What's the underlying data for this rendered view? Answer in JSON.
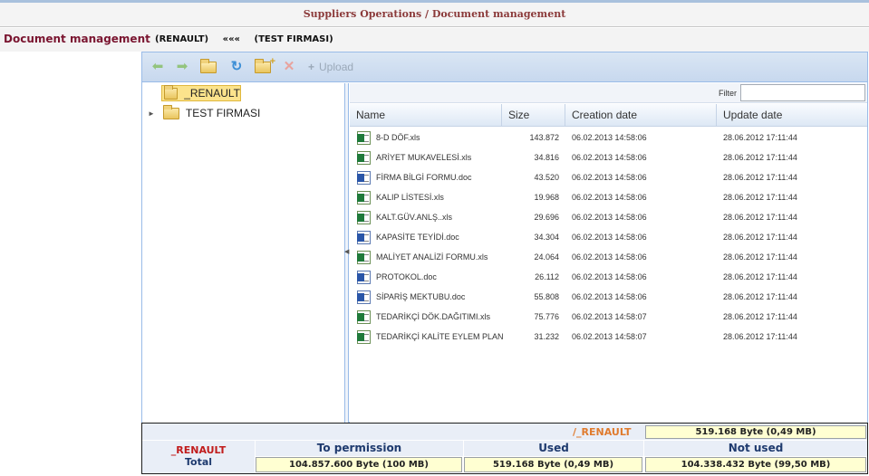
{
  "app": {
    "title": "Suppliers Operations / Document management"
  },
  "header": {
    "section": "Document management",
    "path_left": "(RENAULT)",
    "path_sep": "«««",
    "path_right": "(TEST FIRMASI)"
  },
  "toolbar": {
    "back_icon": "arrow-left-icon",
    "forward_icon": "arrow-right-icon",
    "open_icon": "folder-open-icon",
    "refresh_icon": "refresh-icon",
    "new_folder_icon": "new-folder-icon",
    "delete_icon": "delete-icon",
    "upload_label": "Upload"
  },
  "tree": {
    "nodes": [
      {
        "label": "_RENAULT",
        "selected": true
      },
      {
        "label": "TEST FIRMASI",
        "expandable": true
      }
    ]
  },
  "grid": {
    "filter_label": "Filter",
    "filter_value": "",
    "columns": [
      "Name",
      "Size",
      "Creation date",
      "Update date"
    ],
    "rows": [
      {
        "icon": "excel-file-icon",
        "name": "8-D DÖF.xls",
        "size": "143.872",
        "created": "06.02.2013 14:58:06",
        "updated": "28.06.2012 17:11:44"
      },
      {
        "icon": "excel-file-icon",
        "name": "ARİYET MUKAVELESİ.xls",
        "size": "34.816",
        "created": "06.02.2013 14:58:06",
        "updated": "28.06.2012 17:11:44"
      },
      {
        "icon": "word-file-icon",
        "name": "FİRMA BİLGİ FORMU.doc",
        "size": "43.520",
        "created": "06.02.2013 14:58:06",
        "updated": "28.06.2012 17:11:44"
      },
      {
        "icon": "excel-file-icon",
        "name": "KALIP LİSTESİ.xls",
        "size": "19.968",
        "created": "06.02.2013 14:58:06",
        "updated": "28.06.2012 17:11:44"
      },
      {
        "icon": "excel-file-icon",
        "name": "KALT.GÜV.ANLŞ..xls",
        "size": "29.696",
        "created": "06.02.2013 14:58:06",
        "updated": "28.06.2012 17:11:44"
      },
      {
        "icon": "word-file-icon",
        "name": "KAPASİTE TEYİDİ.doc",
        "size": "34.304",
        "created": "06.02.2013 14:58:06",
        "updated": "28.06.2012 17:11:44"
      },
      {
        "icon": "excel-file-icon",
        "name": "MALİYET ANALİZİ FORMU.xls",
        "size": "24.064",
        "created": "06.02.2013 14:58:06",
        "updated": "28.06.2012 17:11:44"
      },
      {
        "icon": "word-file-icon",
        "name": "PROTOKOL.doc",
        "size": "26.112",
        "created": "06.02.2013 14:58:06",
        "updated": "28.06.2012 17:11:44"
      },
      {
        "icon": "word-file-icon",
        "name": "SİPARİŞ MEKTUBU.doc",
        "size": "55.808",
        "created": "06.02.2013 14:58:06",
        "updated": "28.06.2012 17:11:44"
      },
      {
        "icon": "excel-file-icon",
        "name": "TEDARİKÇİ DÖK.DAĞITIMI.xls",
        "size": "75.776",
        "created": "06.02.2013 14:58:07",
        "updated": "28.06.2012 17:11:44"
      },
      {
        "icon": "excel-file-icon",
        "name": "TEDARİKÇİ KALİTE EYLEM PLAN",
        "size": "31.232",
        "created": "06.02.2013 14:58:07",
        "updated": "28.06.2012 17:11:44"
      }
    ]
  },
  "footer": {
    "current_path": "/_RENAULT",
    "current_path_size": "519.168 Byte (0,49 MB)",
    "owner": "_RENAULT",
    "total_label": "Total",
    "perm_label": "To permission",
    "used_label": "Used",
    "notused_label": "Not used",
    "perm_value": "104.857.600 Byte (100 MB)",
    "used_value": "519.168 Byte (0,49 MB)",
    "notused_value": "104.338.432 Byte (99,50 MB)"
  },
  "colors": {
    "title": "#8b3a3a",
    "section": "#7a1530",
    "panel_border": "#99bbe8",
    "selected_node": "#fbe38c",
    "footer_path": "#e07b2e",
    "owner": "#c11c1c",
    "footer_header": "#1e3a6e",
    "value_box": "#ffffd2"
  }
}
